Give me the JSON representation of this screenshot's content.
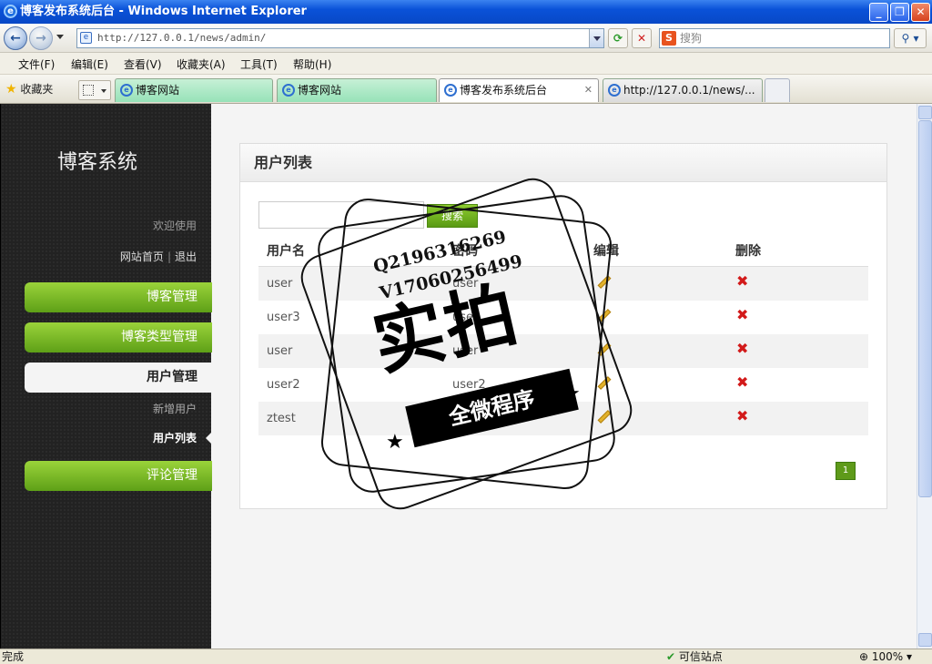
{
  "window": {
    "title": "博客发布系统后台 - Windows Internet Explorer",
    "url": "http://127.0.0.1/news/admin/",
    "search_placeholder": "搜狗",
    "menu": [
      "文件(F)",
      "编辑(E)",
      "查看(V)",
      "收藏夹(A)",
      "工具(T)",
      "帮助(H)"
    ],
    "favorites_label": "收藏夹",
    "tabs": [
      {
        "label": "博客网站"
      },
      {
        "label": "博客网站"
      },
      {
        "label": "博客发布系统后台"
      },
      {
        "label": "http://127.0.0.1/news/..."
      }
    ],
    "status_text": "完成",
    "trusted_zone": "可信站点",
    "zoom": "100%"
  },
  "sidebar": {
    "title": "博客系统",
    "welcome": "欢迎使用",
    "home_link": "网站首页",
    "logout_link": "退出",
    "menu": [
      {
        "label": "博客管理"
      },
      {
        "label": "博客类型管理"
      },
      {
        "label": "用户管理"
      },
      {
        "label": "评论管理"
      }
    ],
    "submenu": [
      {
        "label": "新增用户"
      },
      {
        "label": "用户列表"
      }
    ]
  },
  "panel": {
    "title": "用户列表",
    "search_button": "搜索",
    "columns": [
      "用户名",
      "密码",
      "编辑",
      "删除"
    ],
    "rows": [
      {
        "username": "user",
        "password": "user"
      },
      {
        "username": "user3",
        "password": "user"
      },
      {
        "username": "user",
        "password": "user"
      },
      {
        "username": "user2",
        "password": "user2"
      },
      {
        "username": "ztest",
        "password": ""
      }
    ],
    "page": "1"
  },
  "watermark": {
    "line1": "Q2196316269",
    "line2": "V17060256499",
    "big": "实拍",
    "band": "全微程序"
  }
}
